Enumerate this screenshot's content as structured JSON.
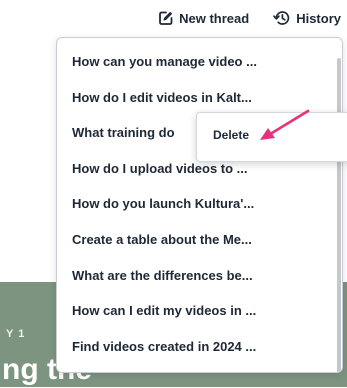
{
  "toolbar": {
    "new_thread_label": "New thread",
    "new_thread_icon": "edit-square-icon",
    "history_label": "History",
    "history_icon": "history-clock-icon"
  },
  "threads": [
    "How can you manage video ...",
    "How do I edit videos in Kalt...",
    "What training do",
    "How do I upload videos to ...",
    "How do you launch Kultura'...",
    "Create a table about the Me...",
    "What are the differences be...",
    "How can I edit my videos in ...",
    "Find videos created in 2024 ..."
  ],
  "context_menu": {
    "delete_label": "Delete"
  },
  "background": {
    "eyebrow": "Y 1",
    "heading": "ng the",
    "banner_color": "#7d9480"
  },
  "colors": {
    "text": "#1e2836",
    "annotation_arrow": "#e8317a"
  }
}
